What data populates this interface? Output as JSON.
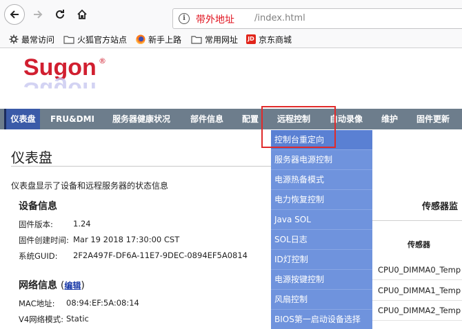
{
  "browser": {
    "url_host": "带外地址",
    "url_path": "/index.html",
    "bookmarks": [
      {
        "label": "最常访问",
        "icon": "gear-icon"
      },
      {
        "label": "火狐官方站点",
        "icon": "folder-icon"
      },
      {
        "label": "新手上路",
        "icon": "firefox-icon"
      },
      {
        "label": "常用网址",
        "icon": "folder-icon"
      },
      {
        "label": "京东商城",
        "icon": "jd-icon"
      }
    ],
    "jd_badge": "JD"
  },
  "brand": {
    "logo": "Sugon",
    "reg_mark": "®",
    "color": "#d11f30"
  },
  "menu": {
    "items": [
      "仪表盘",
      "FRU&DMI",
      "服务器健康状况",
      "部件信息",
      "配置",
      "远程控制",
      "自动录像",
      "维护",
      "固件更新"
    ],
    "active_index": 0,
    "accent": "#3b5ba8"
  },
  "dropdown": {
    "items": [
      "控制台重定向",
      "服务器电源控制",
      "电源热备模式",
      "电力恢复控制",
      "Java SOL",
      "SOL日志",
      "ID灯控制",
      "电源按键控制",
      "风扇控制",
      "BIOS第一启动设备选择"
    ]
  },
  "main": {
    "title": "仪表盘",
    "description": "仪表盘显示了设备和远程服务器的状态信息",
    "device_info": {
      "title": "设备信息",
      "rows": [
        {
          "label": "固件版本:",
          "value": "1.24"
        },
        {
          "label": "固件创建时间:",
          "value": "Mar 19 2018 17:30:00 CST"
        },
        {
          "label": "系统GUID:",
          "value": "2F2A497F-DF6A-11E7-9DEC-0894EF5A0814"
        }
      ]
    },
    "network_info": {
      "title": "网络信息",
      "edit_label": "编辑",
      "rows": [
        {
          "label": "MAC地址:",
          "value": "08:94:EF:5A:08:14"
        },
        {
          "label": "V4网络模式:",
          "value": "Static"
        }
      ]
    }
  },
  "sensor": {
    "title": "传感器监",
    "column_header": "传感器",
    "rows": [
      "CPU0_DIMMA0_Temp",
      "CPU0_DIMMA1_Temp",
      "CPU0_DIMMA2_Temp"
    ]
  }
}
